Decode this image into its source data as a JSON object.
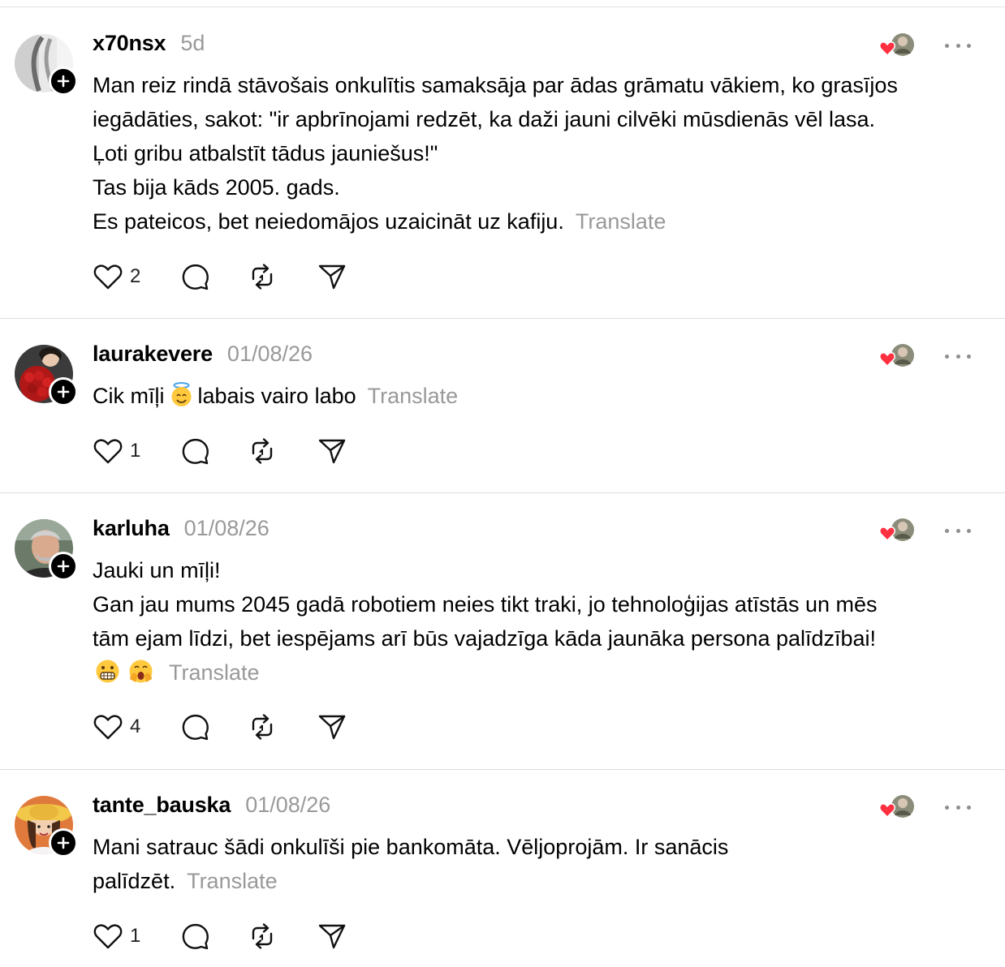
{
  "posts": [
    {
      "username": "x70nsx",
      "time": "5d",
      "lines": [
        "Man reiz rindā stāvošais onkulītis samaksāja par ādas grāmatu vākiem, ko grasījos",
        "iegādāties, sakot: \"ir apbrīnojami redzēt, ka daži jauni cilvēki mūsdienās vēl lasa.",
        "Ļoti gribu atbalstīt tādus jauniešus!\"",
        "Tas bija kāds 2005. gads.",
        "Es pateicos, bet neiedomājos uzaicināt uz kafiju."
      ],
      "translate": "Translate",
      "likes": "2"
    },
    {
      "username": "laurakevere",
      "time": "01/08/26",
      "text_before_emoji": "Cik mīļi",
      "text_after_emoji": "labais vairo labo",
      "emoji": "smiling-face-with-halo",
      "translate": "Translate",
      "likes": "1"
    },
    {
      "username": "karluha",
      "time": "01/08/26",
      "lines": [
        "Jauki un mīļi!",
        "Gan jau mums 2045 gadā robotiem neies tikt traki, jo tehnoloģijas atīstās un mēs",
        "tām ejam līdzi, bet iespējams arī būs vajadzīga kāda jaunāka persona palīdzībai!"
      ],
      "emojis": [
        "grimacing-face",
        "face-with-open-mouth-hand"
      ],
      "translate": "Translate",
      "likes": "4"
    },
    {
      "username": "tante_bauska",
      "time": "01/08/26",
      "lines": [
        "Mani satrauc šādi onkulīši pie bankomāta. Vēljoprojām. Ir sanācis",
        "palīdzēt."
      ],
      "translate": "Translate",
      "likes": "1"
    }
  ],
  "icons": {
    "like": "heart-icon",
    "reply": "comment-bubble-icon",
    "repost": "repost-icon",
    "share": "send-icon",
    "more": "more-options-icon",
    "follow": "plus-icon"
  },
  "colors": {
    "heart_red": "#ff3040",
    "muted": "#999999",
    "divider": "#dcdcdc"
  }
}
